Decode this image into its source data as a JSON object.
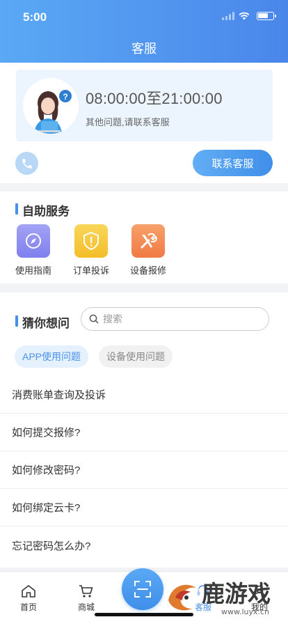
{
  "status_bar": {
    "time": "5:00"
  },
  "header": {
    "title": "客服"
  },
  "service_hours": {
    "hours": "08:00:00至21:00:00",
    "subtitle": "其他问题,请联系客服"
  },
  "contact": {
    "button_label": "联系客服"
  },
  "self_service": {
    "title": "自助服务",
    "items": [
      {
        "label": "使用指南",
        "icon": "compass-icon",
        "color": "#8d8df2"
      },
      {
        "label": "订单投诉",
        "icon": "shield-alert-icon",
        "color": "#f6c53a"
      },
      {
        "label": "设备报修",
        "icon": "tools-icon",
        "color": "#f48a55"
      }
    ]
  },
  "guess": {
    "title": "猜你想问",
    "search_placeholder": "搜索",
    "tabs": [
      {
        "label": "APP使用问题",
        "active": true
      },
      {
        "label": "设备使用问题",
        "active": false
      }
    ],
    "questions": [
      "消费账单查询及投诉",
      "如何提交报修?",
      "如何修改密码?",
      "如何绑定云卡?",
      "忘记密码怎么办?"
    ]
  },
  "tabbar": {
    "items": [
      {
        "label": "首页",
        "icon": "home-icon"
      },
      {
        "label": "商城",
        "icon": "cart-icon"
      },
      {
        "label": "客服",
        "icon": "service-icon"
      },
      {
        "label": "我的",
        "icon": "user-icon"
      }
    ],
    "scan_icon": "scan-icon"
  },
  "watermark": {
    "text": "鹿游戏",
    "url_text": "www.luyx.cn"
  },
  "colors": {
    "primary": "#4a90ea",
    "header_start": "#5aa9f5",
    "header_end": "#4a86ea"
  }
}
